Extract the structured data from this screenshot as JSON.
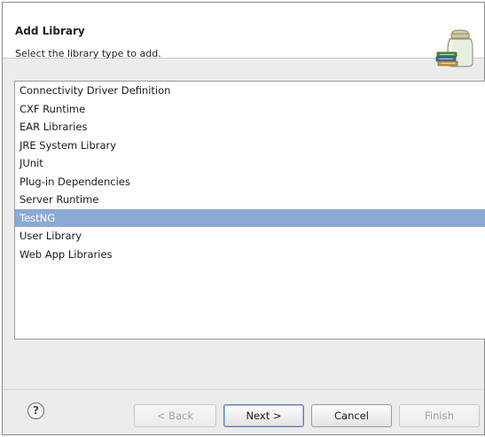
{
  "header": {
    "title": "Add Library",
    "subtitle": "Select the library type to add.",
    "icon": "library-jar-icon"
  },
  "library_types": {
    "items": [
      "Connectivity Driver Definition",
      "CXF Runtime",
      "EAR Libraries",
      "JRE System Library",
      "JUnit",
      "Plug-in Dependencies",
      "Server Runtime",
      "TestNG",
      "User Library",
      "Web App Libraries"
    ],
    "selected": "TestNG"
  },
  "footer": {
    "help_icon": "help-icon",
    "help_glyph": "?",
    "back_label": "< Back",
    "next_label": "Next >",
    "cancel_label": "Cancel",
    "finish_label": "Finish"
  },
  "colors": {
    "selection": "#8aa9d5",
    "disabled_text": "#a0a0a0"
  }
}
